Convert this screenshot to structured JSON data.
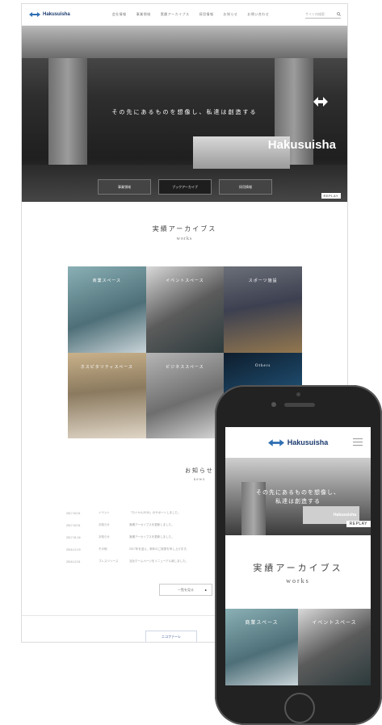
{
  "desktop": {
    "logo_text": "Hakusuisha",
    "nav": [
      "会社情報",
      "事業領域",
      "実績アーカイブス",
      "採用情報",
      "お知らせ",
      "お問い合わせ"
    ],
    "search": {
      "placeholder": "サイト内検索"
    },
    "hero": {
      "tagline": "その先にあるものを想像し、私達は創造する",
      "brand": "Hakusuisha",
      "thumbs": [
        "事業領域",
        "ブックアーカイブ",
        "採用情報"
      ],
      "replay": "REPLAY"
    },
    "works": {
      "title": "実績アーカイブス",
      "subtitle": "works",
      "tiles": [
        "商業スペース",
        "イベントスペース",
        "スポーツ施設",
        "ホスピタリティスペース",
        "ビジネススペース",
        "Others"
      ]
    },
    "news": {
      "title": "お知らせ",
      "subtitle": "news",
      "items": [
        {
          "date": "2017.02.01",
          "cat": "イベント",
          "text": "「ロイヤル2015」のサポートしました。"
        },
        {
          "date": "2017.02.01",
          "cat": "お知らせ",
          "text": "実績アーカイブスを更新しました。"
        },
        {
          "date": "2017.01.16",
          "cat": "お知らせ",
          "text": "実績アーカイブスを更新しました。"
        },
        {
          "date": "2016.12.19",
          "cat": "その他",
          "text": "2017年を迎え、新年のご挨拶を申し上げます。"
        },
        {
          "date": "2016.12.01",
          "cat": "プレスリリース",
          "text": "当社ホームページをリニューアル致しました。"
        }
      ],
      "more": "一覧を見る"
    },
    "banner": "ニコファーレ"
  },
  "mobile": {
    "logo_text": "Hakusuisha",
    "hero": {
      "tagline_1": "その先にあるものを想像し、",
      "tagline_2": "私達は創造する",
      "brand": "Hakusuisha",
      "replay": "REPLAY"
    },
    "works": {
      "title": "実績アーカイブス",
      "subtitle": "works",
      "tiles": [
        "商業スペース",
        "イベントスペース"
      ]
    }
  },
  "colors": {
    "brand": "#1a3a6e",
    "accent": "#2f6fb3"
  }
}
